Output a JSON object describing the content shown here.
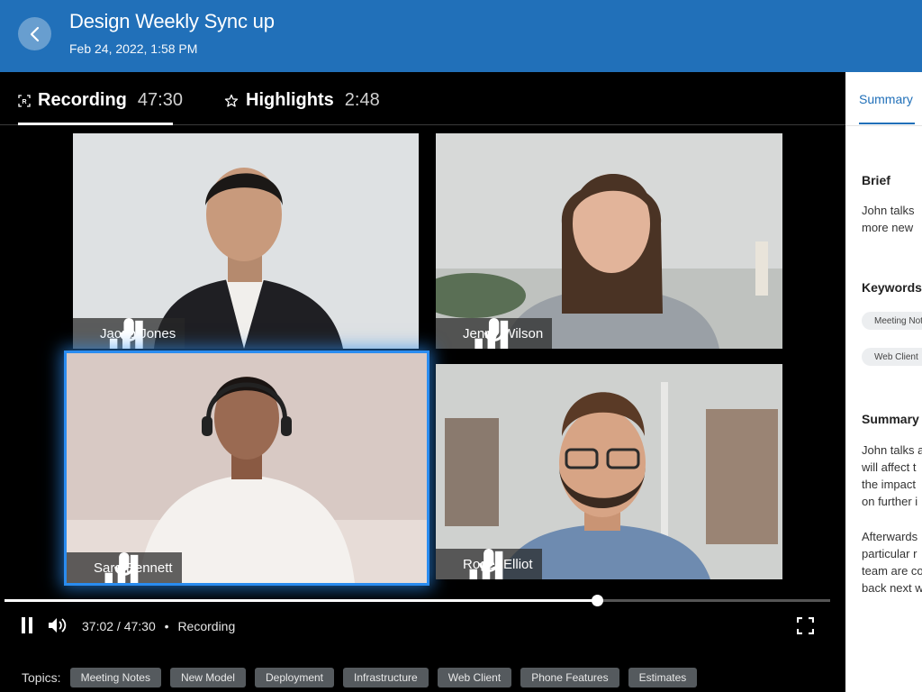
{
  "header": {
    "title": "Design Weekly Sync up",
    "date": "Feb 24, 2022, 1:58 PM",
    "background": "#2170b9"
  },
  "tabs": [
    {
      "label": "Recording",
      "time": "47:30",
      "icon": "recording-icon",
      "active": true
    },
    {
      "label": "Highlights",
      "time": "2:48",
      "icon": "star-icon",
      "active": false
    }
  ],
  "participants": [
    {
      "name": "Jacob Jones"
    },
    {
      "name": "Jenny Wilson"
    },
    {
      "name": "Sara Bennett",
      "active_speaker": true
    },
    {
      "name": "Roger Elliot"
    }
  ],
  "player": {
    "timecode": "37:02 / 47:30",
    "separator": "•",
    "status": "Recording",
    "progress": 0.718,
    "icons": [
      "pause-icon",
      "volume-icon",
      "fullscreen-icon"
    ]
  },
  "topics": {
    "label": "Topics:",
    "items": [
      "Meeting Notes",
      "New Model",
      "Deployment",
      "Infrastructure",
      "Web Client",
      "Phone Features",
      "Estimates"
    ]
  },
  "side_panel": {
    "tab": "Summary",
    "brief_heading": "Brief",
    "brief_lines": [
      "John talks",
      "more new"
    ],
    "keywords_heading": "Keywords",
    "keywords": [
      "Meeting Not",
      "Web Client"
    ],
    "summary_heading": "Summary",
    "summary_lines": [
      "John talks a",
      "will affect t",
      "the impact",
      "on further i"
    ],
    "summary_lines_2": [
      "Afterwards",
      "particular r",
      "team are co",
      "back next w"
    ]
  },
  "colors": {
    "accent": "#2170b9",
    "active_border": "#2a8cf0",
    "chip": "#555a5e"
  }
}
